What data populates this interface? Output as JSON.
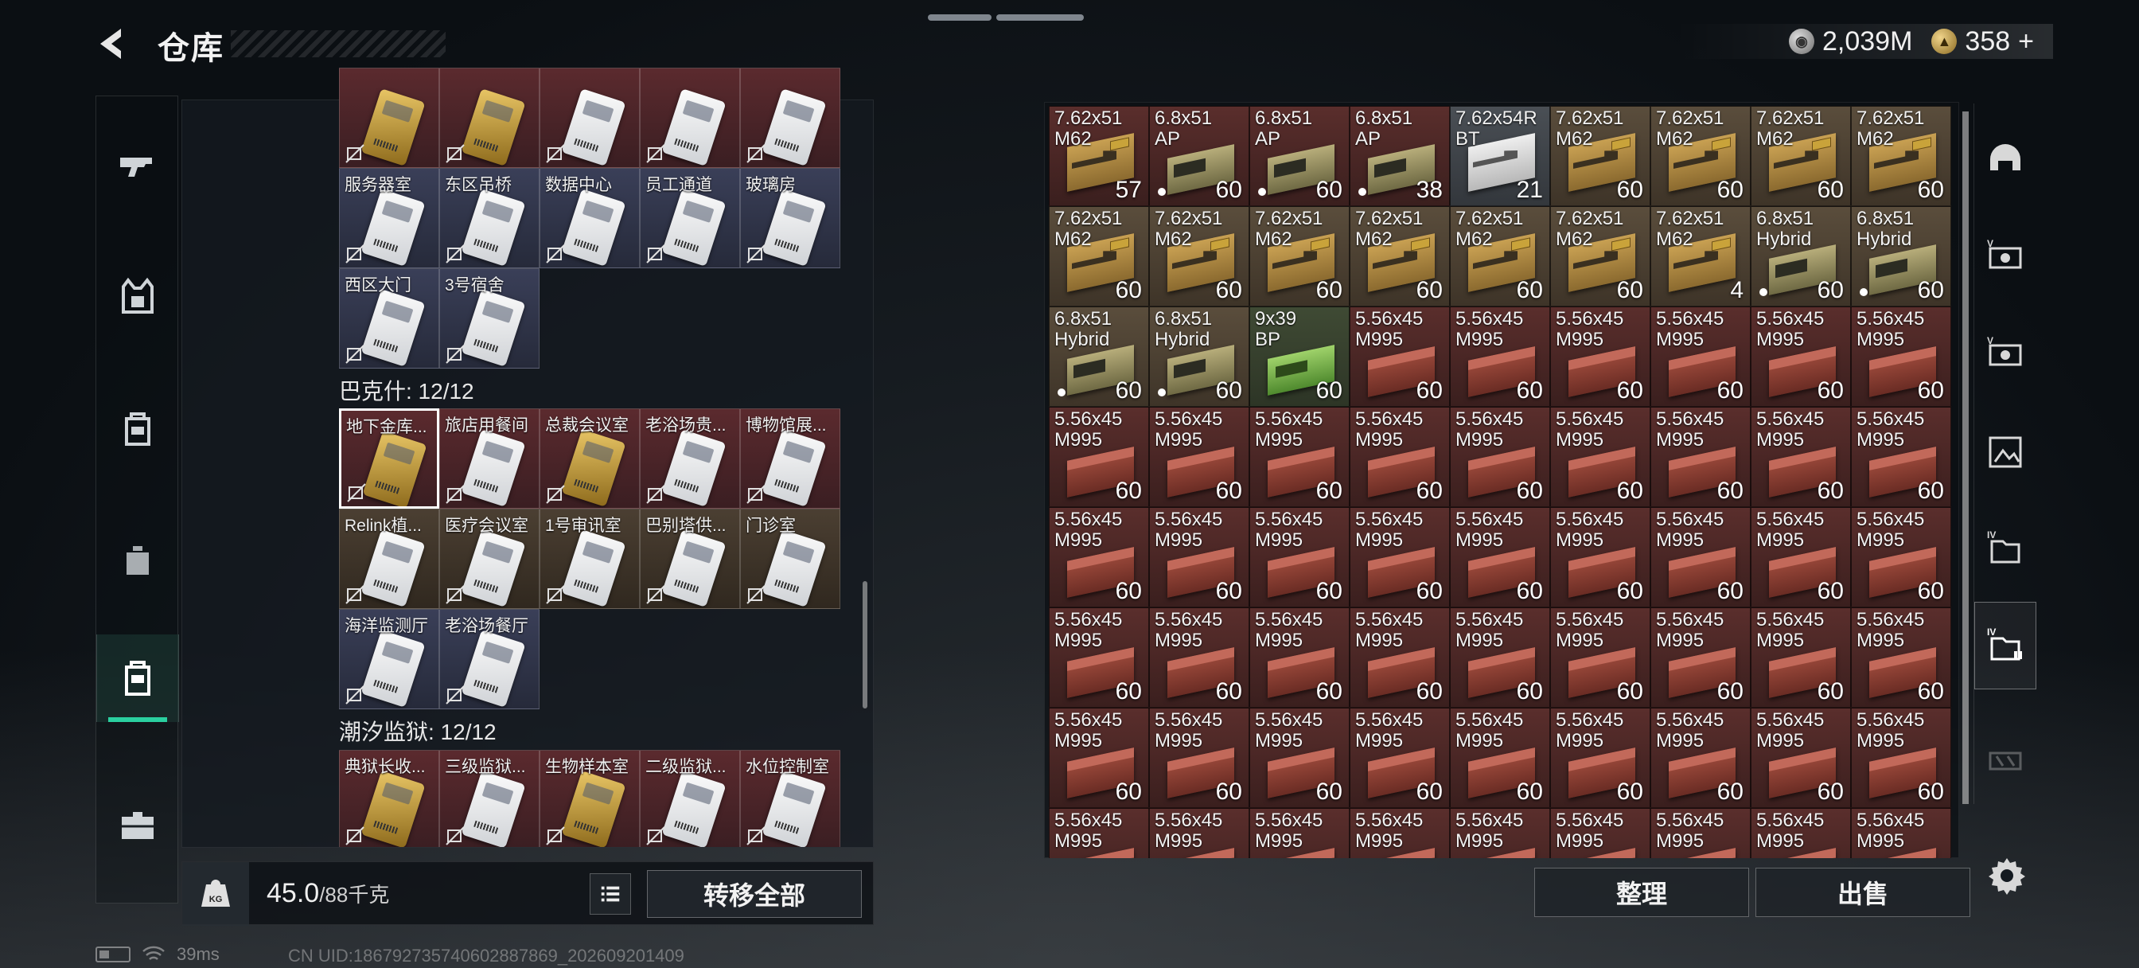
{
  "header": {
    "title": "仓库"
  },
  "currency": {
    "silver": "2,039M",
    "gold": "358",
    "add": "+"
  },
  "rail": [
    "weapon-icon",
    "armor-vest-icon",
    "backpack-icon",
    "pouch-icon",
    "keycard-case-icon",
    "toolbox-icon"
  ],
  "keycards_top": [
    {
      "name": "",
      "color": "red",
      "card": "gold"
    },
    {
      "name": "",
      "color": "red",
      "card": "gold"
    },
    {
      "name": "",
      "color": "red",
      "card": "white"
    },
    {
      "name": "",
      "color": "red",
      "card": "white"
    },
    {
      "name": "",
      "color": "red",
      "card": "white"
    },
    {
      "name": "服务器室",
      "color": "blue",
      "card": "white"
    },
    {
      "name": "东区吊桥",
      "color": "blue",
      "card": "white"
    },
    {
      "name": "数据中心",
      "color": "blue",
      "card": "white"
    },
    {
      "name": "员工通道",
      "color": "blue",
      "card": "white"
    },
    {
      "name": "玻璃房",
      "color": "blue",
      "card": "white"
    },
    {
      "name": "西区大门",
      "color": "blue",
      "card": "white"
    },
    {
      "name": "3号宿舍",
      "color": "blue",
      "card": "white"
    }
  ],
  "section_bakesh": {
    "label": "巴克什: 12/12"
  },
  "keycards_bakesh": [
    {
      "name": "地下金库...",
      "color": "red",
      "card": "gold",
      "selected": true
    },
    {
      "name": "旅店用餐间",
      "color": "red",
      "card": "white"
    },
    {
      "name": "总裁会议室",
      "color": "red",
      "card": "gold"
    },
    {
      "name": "老浴场贵...",
      "color": "red",
      "card": "white"
    },
    {
      "name": "博物馆展...",
      "color": "red",
      "card": "white"
    },
    {
      "name": "Relink植...",
      "color": "brown",
      "card": "white"
    },
    {
      "name": "医疗会议室",
      "color": "brown",
      "card": "white"
    },
    {
      "name": "1号审讯室",
      "color": "brown",
      "card": "white"
    },
    {
      "name": "巴别塔供...",
      "color": "brown",
      "card": "white"
    },
    {
      "name": "门诊室",
      "color": "brown",
      "card": "white"
    },
    {
      "name": "海洋监测厅",
      "color": "blue",
      "card": "white"
    },
    {
      "name": "老浴场餐厅",
      "color": "blue",
      "card": "white"
    }
  ],
  "section_tide": {
    "label": "潮汐监狱: 12/12"
  },
  "keycards_tide": [
    {
      "name": "典狱长收...",
      "color": "red",
      "card": "gold"
    },
    {
      "name": "三级监狱...",
      "color": "red",
      "card": "white"
    },
    {
      "name": "生物样本室",
      "color": "red",
      "card": "gold"
    },
    {
      "name": "二级监狱...",
      "color": "red",
      "card": "white"
    },
    {
      "name": "水位控制室",
      "color": "red",
      "card": "white"
    }
  ],
  "weight": {
    "current": "45.0",
    "max": "/88千克"
  },
  "buttons": {
    "transfer_all": "转移全部",
    "sort": "整理",
    "sell": "出售"
  },
  "stash": [
    {
      "cal": "7.62x51\nM62",
      "count": "57",
      "box": "kraft",
      "bg": "red"
    },
    {
      "cal": "6.8x51\nAP",
      "count": "60",
      "box": "olive",
      "bg": "red",
      "dot": true
    },
    {
      "cal": "6.8x51\nAP",
      "count": "60",
      "box": "olive",
      "bg": "red",
      "dot": true
    },
    {
      "cal": "6.8x51\nAP",
      "count": "38",
      "box": "olive",
      "bg": "red",
      "dot": true
    },
    {
      "cal": "7.62x54R\nBT",
      "count": "21",
      "box": "white",
      "bg": "gray"
    },
    {
      "cal": "7.62x51\nM62",
      "count": "60",
      "box": "kraft",
      "bg": "tan"
    },
    {
      "cal": "7.62x51\nM62",
      "count": "60",
      "box": "kraft",
      "bg": "tan"
    },
    {
      "cal": "7.62x51\nM62",
      "count": "60",
      "box": "kraft",
      "bg": "tan"
    },
    {
      "cal": "7.62x51\nM62",
      "count": "60",
      "box": "kraft",
      "bg": "tan"
    },
    {
      "cal": "7.62x51\nM62",
      "count": "60",
      "box": "kraft",
      "bg": "tan"
    },
    {
      "cal": "7.62x51\nM62",
      "count": "60",
      "box": "kraft",
      "bg": "tan"
    },
    {
      "cal": "7.62x51\nM62",
      "count": "60",
      "box": "kraft",
      "bg": "tan"
    },
    {
      "cal": "7.62x51\nM62",
      "count": "60",
      "box": "kraft",
      "bg": "tan"
    },
    {
      "cal": "7.62x51\nM62",
      "count": "60",
      "box": "kraft",
      "bg": "tan"
    },
    {
      "cal": "7.62x51\nM62",
      "count": "60",
      "box": "kraft",
      "bg": "tan"
    },
    {
      "cal": "7.62x51\nM62",
      "count": "4",
      "box": "kraft",
      "bg": "tan"
    },
    {
      "cal": "6.8x51\nHybrid",
      "count": "60",
      "box": "olive",
      "bg": "tan",
      "dot": true
    },
    {
      "cal": "6.8x51\nHybrid",
      "count": "60",
      "box": "olive",
      "bg": "tan",
      "dot": true
    },
    {
      "cal": "6.8x51\nHybrid",
      "count": "60",
      "box": "olive",
      "bg": "tan",
      "dot": true
    },
    {
      "cal": "6.8x51\nHybrid",
      "count": "60",
      "box": "olive",
      "bg": "tan",
      "dot": true
    },
    {
      "cal": "9x39\nBP",
      "count": "60",
      "box": "lime",
      "bg": "green"
    },
    {
      "cal": "5.56x45\nM995",
      "count": "60",
      "box": "redbox",
      "bg": "red"
    },
    {
      "cal": "5.56x45\nM995",
      "count": "60",
      "box": "redbox",
      "bg": "red"
    },
    {
      "cal": "5.56x45\nM995",
      "count": "60",
      "box": "redbox",
      "bg": "red"
    },
    {
      "cal": "5.56x45\nM995",
      "count": "60",
      "box": "redbox",
      "bg": "red"
    },
    {
      "cal": "5.56x45\nM995",
      "count": "60",
      "box": "redbox",
      "bg": "red"
    },
    {
      "cal": "5.56x45\nM995",
      "count": "60",
      "box": "redbox",
      "bg": "red"
    },
    {
      "cal": "5.56x45\nM995",
      "count": "60",
      "box": "redbox",
      "bg": "red"
    },
    {
      "cal": "5.56x45\nM995",
      "count": "60",
      "box": "redbox",
      "bg": "red"
    },
    {
      "cal": "5.56x45\nM995",
      "count": "60",
      "box": "redbox",
      "bg": "red"
    },
    {
      "cal": "5.56x45\nM995",
      "count": "60",
      "box": "redbox",
      "bg": "red"
    },
    {
      "cal": "5.56x45\nM995",
      "count": "60",
      "box": "redbox",
      "bg": "red"
    },
    {
      "cal": "5.56x45\nM995",
      "count": "60",
      "box": "redbox",
      "bg": "red"
    },
    {
      "cal": "5.56x45\nM995",
      "count": "60",
      "box": "redbox",
      "bg": "red"
    },
    {
      "cal": "5.56x45\nM995",
      "count": "60",
      "box": "redbox",
      "bg": "red"
    },
    {
      "cal": "5.56x45\nM995",
      "count": "60",
      "box": "redbox",
      "bg": "red"
    },
    {
      "cal": "5.56x45\nM995",
      "count": "60",
      "box": "redbox",
      "bg": "red"
    },
    {
      "cal": "5.56x45\nM995",
      "count": "60",
      "box": "redbox",
      "bg": "red"
    },
    {
      "cal": "5.56x45\nM995",
      "count": "60",
      "box": "redbox",
      "bg": "red"
    },
    {
      "cal": "5.56x45\nM995",
      "count": "60",
      "box": "redbox",
      "bg": "red"
    },
    {
      "cal": "5.56x45\nM995",
      "count": "60",
      "box": "redbox",
      "bg": "red"
    },
    {
      "cal": "5.56x45\nM995",
      "count": "60",
      "box": "redbox",
      "bg": "red"
    },
    {
      "cal": "5.56x45\nM995",
      "count": "60",
      "box": "redbox",
      "bg": "red"
    },
    {
      "cal": "5.56x45\nM995",
      "count": "60",
      "box": "redbox",
      "bg": "red"
    },
    {
      "cal": "5.56x45\nM995",
      "count": "60",
      "box": "redbox",
      "bg": "red"
    },
    {
      "cal": "5.56x45\nM995",
      "count": "60",
      "box": "redbox",
      "bg": "red"
    },
    {
      "cal": "5.56x45\nM995",
      "count": "60",
      "box": "redbox",
      "bg": "red"
    },
    {
      "cal": "5.56x45\nM995",
      "count": "60",
      "box": "redbox",
      "bg": "red"
    },
    {
      "cal": "5.56x45\nM995",
      "count": "60",
      "box": "redbox",
      "bg": "red"
    },
    {
      "cal": "5.56x45\nM995",
      "count": "60",
      "box": "redbox",
      "bg": "red"
    },
    {
      "cal": "5.56x45\nM995",
      "count": "60",
      "box": "redbox",
      "bg": "red"
    },
    {
      "cal": "5.56x45\nM995",
      "count": "60",
      "box": "redbox",
      "bg": "red"
    },
    {
      "cal": "5.56x45\nM995",
      "count": "60",
      "box": "redbox",
      "bg": "red"
    },
    {
      "cal": "5.56x45\nM995",
      "count": "60",
      "box": "redbox",
      "bg": "red"
    },
    {
      "cal": "5.56x45\nM995",
      "count": "60",
      "box": "redbox",
      "bg": "red"
    },
    {
      "cal": "5.56x45\nM995",
      "count": "60",
      "box": "redbox",
      "bg": "red"
    },
    {
      "cal": "5.56x45\nM995",
      "count": "60",
      "box": "redbox",
      "bg": "red"
    },
    {
      "cal": "5.56x45\nM995",
      "count": "60",
      "box": "redbox",
      "bg": "red"
    },
    {
      "cal": "5.56x45\nM995",
      "count": "60",
      "box": "redbox",
      "bg": "red"
    },
    {
      "cal": "5.56x45\nM995",
      "count": "60",
      "box": "redbox",
      "bg": "red"
    },
    {
      "cal": "5.56x45\nM995",
      "count": "60",
      "box": "redbox",
      "bg": "red"
    },
    {
      "cal": "5.56x45\nM995",
      "count": "60",
      "box": "redbox",
      "bg": "red"
    },
    {
      "cal": "5.56x45\nM995",
      "count": "60",
      "box": "redbox",
      "bg": "red"
    },
    {
      "cal": "5.56x45\nM995",
      "count": "",
      "box": "redbox",
      "bg": "red"
    },
    {
      "cal": "5.56x45\nM995",
      "count": "",
      "box": "redbox",
      "bg": "red"
    },
    {
      "cal": "5.56x45\nM995",
      "count": "",
      "box": "redbox",
      "bg": "red"
    },
    {
      "cal": "5.56x45\nM995",
      "count": "",
      "box": "redbox",
      "bg": "red"
    },
    {
      "cal": "5.56x45\nM995",
      "count": "",
      "box": "redbox",
      "bg": "red"
    },
    {
      "cal": "5.56x45\nM995",
      "count": "",
      "box": "redbox",
      "bg": "red"
    },
    {
      "cal": "5.56x45\nM995",
      "count": "",
      "box": "redbox",
      "bg": "red"
    },
    {
      "cal": "5.56x45\nM995",
      "count": "",
      "box": "redbox",
      "bg": "red"
    },
    {
      "cal": "5.56x45\nM995",
      "count": "",
      "box": "redbox",
      "bg": "red"
    }
  ],
  "right_rail": [
    "helmet-icon",
    "rig-slot-1-icon",
    "rig-slot-2-icon",
    "case-slot-icon",
    "stash-page-4-icon",
    "stash-page-5-icon",
    "stash-page-6-icon"
  ],
  "status": {
    "ping": "39ms",
    "uid": "CN UID:18679273574060288786​9_202609201409"
  },
  "colors": {
    "accent": "#2ad0a0",
    "selected_border": "#ffffff"
  }
}
